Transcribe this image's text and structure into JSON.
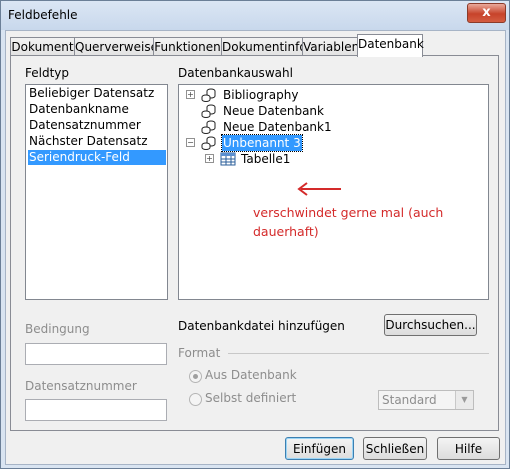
{
  "window": {
    "title": "Feldbefehle",
    "close_glyph": "x"
  },
  "tabs": [
    "Dokument",
    "Querverweise",
    "Funktionen",
    "Dokumentinfo",
    "Variablen",
    "Datenbank"
  ],
  "feldtyp": {
    "label": "Feldtyp",
    "items": [
      "Beliebiger Datensatz",
      "Datenbankname",
      "Datensatznummer",
      "Nächster Datensatz",
      "Seriendruck-Feld"
    ],
    "selected": "Seriendruck-Feld"
  },
  "datenbankauswahl": {
    "label": "Datenbankauswahl",
    "items": [
      {
        "label": "Bibliography",
        "expander": "+"
      },
      {
        "label": "Neue Datenbank",
        "expander": ""
      },
      {
        "label": "Neue Datenbank1",
        "expander": ""
      },
      {
        "label": "Unbenannt 3",
        "expander": "−"
      },
      {
        "label": "Tabelle1",
        "expander": "+"
      }
    ],
    "icons": [
      "database-icon",
      "table-icon"
    ]
  },
  "annotation": {
    "text": "verschwindet gerne mal (auch dauerhaft)",
    "color": "#d42a2a"
  },
  "bedingung": {
    "label": "Bedingung",
    "value": ""
  },
  "datensatznummer": {
    "label": "Datensatznummer",
    "value": ""
  },
  "datenbankdatei": {
    "label": "Datenbankdatei hinzufügen",
    "button": "Durchsuchen..."
  },
  "format": {
    "label": "Format",
    "options": [
      "Aus Datenbank",
      "Selbst definiert"
    ],
    "selected": "Aus Datenbank",
    "select_value": "Standard"
  },
  "footer": {
    "insert": "Einfügen",
    "close": "Schließen",
    "help": "Hilfe"
  },
  "colors": {
    "selection": "#3399ff",
    "titlebar": "#dbe6f4",
    "close": "#c7432a"
  }
}
